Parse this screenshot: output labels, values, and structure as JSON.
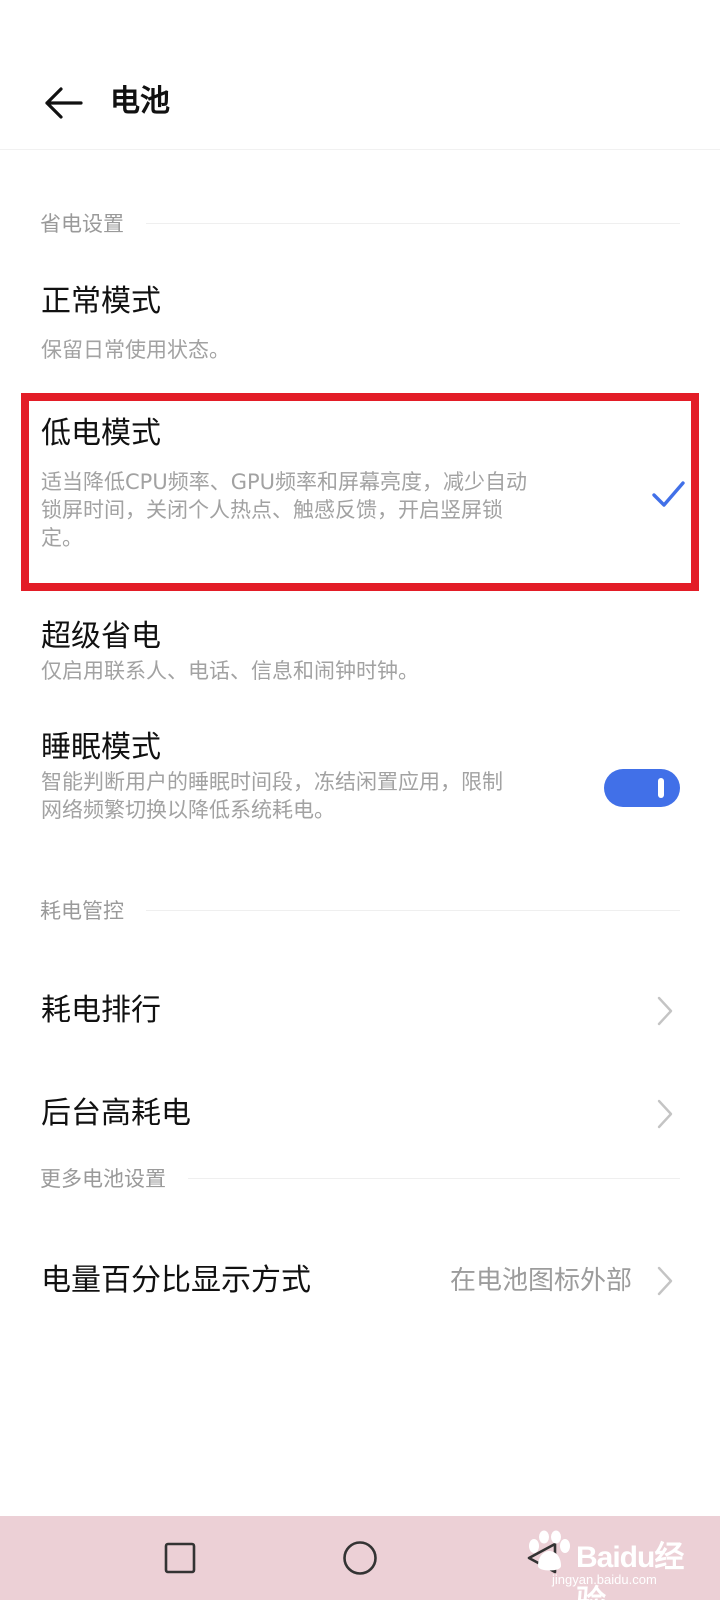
{
  "header": {
    "title": "电池"
  },
  "sections": {
    "power_saving": "省电设置",
    "consumption_control": "耗电管控",
    "more_settings": "更多电池设置"
  },
  "modes": {
    "normal": {
      "title": "正常模式",
      "desc": "保留日常使用状态。"
    },
    "low_power": {
      "title": "低电模式",
      "desc_lines": [
        "适当降低CPU频率、GPU频率和屏幕亮度，减少自动",
        "锁屏时间，关闭个人热点、触感反馈，开启竖屏锁",
        "定。"
      ],
      "selected": true
    },
    "super_saving": {
      "title": "超级省电",
      "desc": "仅启用联系人、电话、信息和闹钟时钟。"
    },
    "sleep": {
      "title": "睡眠模式",
      "desc_lines": [
        "智能判断用户的睡眠时间段，冻结闲置应用，限制",
        "网络频繁切换以降低系统耗电。"
      ],
      "toggle_on": true
    }
  },
  "rows": {
    "ranking": {
      "title": "耗电排行"
    },
    "background": {
      "title": "后台高耗电"
    },
    "percentage": {
      "title": "电量百分比显示方式",
      "value": "在电池图标外部"
    }
  },
  "watermark": {
    "text": "Baidu经验",
    "sub": "jingyan.baidu.com"
  },
  "colors": {
    "accent": "#4170e8",
    "highlight": "#e31d27",
    "navbar": "#ecd0d6"
  },
  "icons": {
    "back": "arrow-left-icon",
    "check": "check-icon",
    "chevron": "chevron-right-icon",
    "nav_recent": "square-icon",
    "nav_home": "circle-icon",
    "nav_back": "triangle-back-icon"
  }
}
